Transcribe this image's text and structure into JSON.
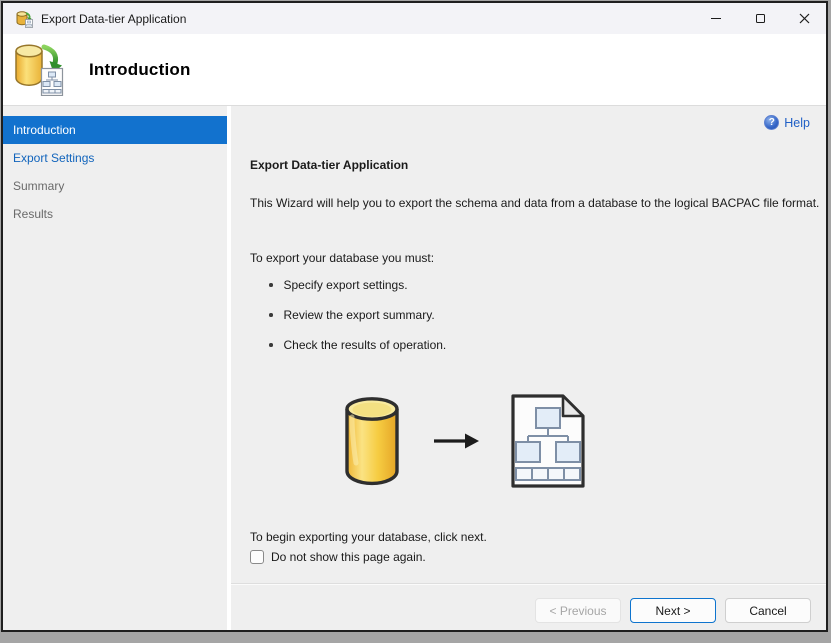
{
  "window": {
    "title": "Export Data-tier Application"
  },
  "header": {
    "title": "Introduction"
  },
  "sidebar": {
    "items": [
      {
        "label": "Introduction",
        "state": "selected"
      },
      {
        "label": "Export Settings",
        "state": "visited"
      },
      {
        "label": "Summary",
        "state": "upcoming"
      },
      {
        "label": "Results",
        "state": "upcoming"
      }
    ]
  },
  "main": {
    "help_label": "Help",
    "heading": "Export Data-tier Application",
    "intro": "This Wizard will help you to export the schema and data from a database to the logical BACPAC file format.",
    "steps_intro": "To export your database you must:",
    "bullets": [
      "Specify export settings.",
      "Review the export summary.",
      "Check the results of operation."
    ],
    "closing": "To begin exporting your database, click next.",
    "checkbox_label": "Do not show this page again.",
    "checkbox_checked": false
  },
  "footer": {
    "previous_label": "< Previous",
    "next_label": "Next >",
    "cancel_label": "Cancel"
  },
  "icons": {
    "help_glyph": "?",
    "app_icon": "database-export-icon",
    "illustration": [
      "database-cylinder",
      "arrow-right",
      "bacpac-file"
    ]
  },
  "colors": {
    "selected_step_bg": "#1272CE",
    "visited_step_text": "#1164BC",
    "help_link": "#1F5FC6",
    "panel_bg": "#EFEFEF",
    "titlebar_bg": "#F3F3F7",
    "next_button_border": "#0E74CE",
    "db_gold": "#F5C93F"
  }
}
